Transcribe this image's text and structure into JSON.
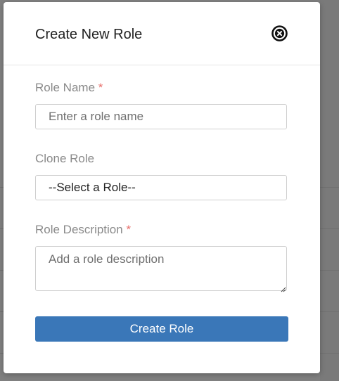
{
  "modal": {
    "title": "Create New Role",
    "close_icon": "close-circle-icon"
  },
  "form": {
    "role_name": {
      "label": "Role Name",
      "required_mark": "*",
      "placeholder": "Enter a role name",
      "value": ""
    },
    "clone_role": {
      "label": "Clone Role",
      "selected": "--Select a Role--"
    },
    "role_description": {
      "label": "Role Description",
      "required_mark": "*",
      "placeholder": "Add a role description",
      "value": ""
    }
  },
  "actions": {
    "submit_label": "Create Role"
  },
  "colors": {
    "primary": "#3a77b8",
    "required": "#e8716d",
    "label": "#8a8a8a"
  }
}
